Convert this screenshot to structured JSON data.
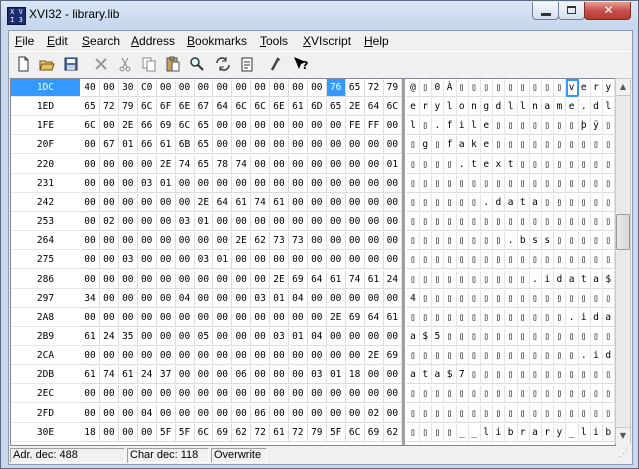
{
  "window": {
    "title": "XVI32 - library.lib",
    "app_icon": "xvi-app-icon",
    "close_glyph": "✕"
  },
  "menu": [
    "File",
    "Edit",
    "Search",
    "Address",
    "Bookmarks",
    "Tools",
    "XVIscript",
    "Help"
  ],
  "menu_hotkeys": [
    "F",
    "E",
    "S",
    "A",
    "B",
    "T",
    "X",
    "H"
  ],
  "toolbar": [
    "new-icon",
    "open-icon",
    "save-icon",
    "delete-icon",
    "cut-icon",
    "copy-icon",
    "paste-icon",
    "find-icon",
    "replace-icon",
    "script-icon",
    "tools-icon",
    "help-icon"
  ],
  "rows": [
    {
      "addr": "1DC",
      "hex": [
        "40",
        "00",
        "30",
        "C0",
        "00",
        "00",
        "00",
        "00",
        "00",
        "00",
        "00",
        "00",
        "00",
        "76",
        "65",
        "72",
        "79",
        "76"
      ],
      "chars": [
        "@",
        "▯",
        "0",
        "À",
        "▯",
        "▯",
        "▯",
        "▯",
        "▯",
        "▯",
        "▯",
        "▯",
        "▯",
        "v",
        "e",
        "r",
        "y",
        "v"
      ]
    },
    {
      "addr": "1ED",
      "hex": [
        "65",
        "72",
        "79",
        "6C",
        "6F",
        "6E",
        "67",
        "64",
        "6C",
        "6C",
        "6E",
        "61",
        "6D",
        "65",
        "2E",
        "64",
        "6C"
      ],
      "chars": [
        "e",
        "r",
        "y",
        "l",
        "o",
        "n",
        "g",
        "d",
        "l",
        "l",
        "n",
        "a",
        "m",
        "e",
        ".",
        "d",
        "l"
      ]
    },
    {
      "addr": "1FE",
      "hex": [
        "6C",
        "00",
        "2E",
        "66",
        "69",
        "6C",
        "65",
        "00",
        "00",
        "00",
        "00",
        "00",
        "00",
        "00",
        "FE",
        "FF",
        "00"
      ],
      "chars": [
        "l",
        "▯",
        ".",
        "f",
        "i",
        "l",
        "e",
        "▯",
        "▯",
        "▯",
        "▯",
        "▯",
        "▯",
        "▯",
        "þ",
        "ÿ",
        "▯"
      ]
    },
    {
      "addr": "20F",
      "hex": [
        "00",
        "67",
        "01",
        "66",
        "61",
        "6B",
        "65",
        "00",
        "00",
        "00",
        "00",
        "00",
        "00",
        "00",
        "00",
        "00",
        "00"
      ],
      "chars": [
        "▯",
        "g",
        "▯",
        "f",
        "a",
        "k",
        "e",
        "▯",
        "▯",
        "▯",
        "▯",
        "▯",
        "▯",
        "▯",
        "▯",
        "▯",
        "▯"
      ]
    },
    {
      "addr": "220",
      "hex": [
        "00",
        "00",
        "00",
        "00",
        "2E",
        "74",
        "65",
        "78",
        "74",
        "00",
        "00",
        "00",
        "00",
        "00",
        "00",
        "00",
        "01"
      ],
      "chars": [
        "▯",
        "▯",
        "▯",
        "▯",
        ".",
        "t",
        "e",
        "x",
        "t",
        "▯",
        "▯",
        "▯",
        "▯",
        "▯",
        "▯",
        "▯",
        "▯"
      ]
    },
    {
      "addr": "231",
      "hex": [
        "00",
        "00",
        "00",
        "03",
        "01",
        "00",
        "00",
        "00",
        "00",
        "00",
        "00",
        "00",
        "00",
        "00",
        "00",
        "00",
        "00"
      ],
      "chars": [
        "▯",
        "▯",
        "▯",
        "▯",
        "▯",
        "▯",
        "▯",
        "▯",
        "▯",
        "▯",
        "▯",
        "▯",
        "▯",
        "▯",
        "▯",
        "▯",
        "▯"
      ]
    },
    {
      "addr": "242",
      "hex": [
        "00",
        "00",
        "00",
        "00",
        "00",
        "00",
        "2E",
        "64",
        "61",
        "74",
        "61",
        "00",
        "00",
        "00",
        "00",
        "00",
        "00"
      ],
      "chars": [
        "▯",
        "▯",
        "▯",
        "▯",
        "▯",
        "▯",
        ".",
        "d",
        "a",
        "t",
        "a",
        "▯",
        "▯",
        "▯",
        "▯",
        "▯",
        "▯"
      ]
    },
    {
      "addr": "253",
      "hex": [
        "00",
        "02",
        "00",
        "00",
        "00",
        "03",
        "01",
        "00",
        "00",
        "00",
        "00",
        "00",
        "00",
        "00",
        "00",
        "00",
        "00"
      ],
      "chars": [
        "▯",
        "▯",
        "▯",
        "▯",
        "▯",
        "▯",
        "▯",
        "▯",
        "▯",
        "▯",
        "▯",
        "▯",
        "▯",
        "▯",
        "▯",
        "▯",
        "▯"
      ]
    },
    {
      "addr": "264",
      "hex": [
        "00",
        "00",
        "00",
        "00",
        "00",
        "00",
        "00",
        "00",
        "2E",
        "62",
        "73",
        "73",
        "00",
        "00",
        "00",
        "00",
        "00"
      ],
      "chars": [
        "▯",
        "▯",
        "▯",
        "▯",
        "▯",
        "▯",
        "▯",
        "▯",
        ".",
        "b",
        "s",
        "s",
        "▯",
        "▯",
        "▯",
        "▯",
        "▯"
      ]
    },
    {
      "addr": "275",
      "hex": [
        "00",
        "00",
        "03",
        "00",
        "00",
        "00",
        "03",
        "01",
        "00",
        "00",
        "00",
        "00",
        "00",
        "00",
        "00",
        "00",
        "00"
      ],
      "chars": [
        "▯",
        "▯",
        "▯",
        "▯",
        "▯",
        "▯",
        "▯",
        "▯",
        "▯",
        "▯",
        "▯",
        "▯",
        "▯",
        "▯",
        "▯",
        "▯",
        "▯"
      ]
    },
    {
      "addr": "286",
      "hex": [
        "00",
        "00",
        "00",
        "00",
        "00",
        "00",
        "00",
        "00",
        "00",
        "00",
        "2E",
        "69",
        "64",
        "61",
        "74",
        "61",
        "24"
      ],
      "chars": [
        "▯",
        "▯",
        "▯",
        "▯",
        "▯",
        "▯",
        "▯",
        "▯",
        "▯",
        "▯",
        ".",
        "i",
        "d",
        "a",
        "t",
        "a",
        "$"
      ]
    },
    {
      "addr": "297",
      "hex": [
        "34",
        "00",
        "00",
        "00",
        "00",
        "04",
        "00",
        "00",
        "00",
        "03",
        "01",
        "04",
        "00",
        "00",
        "00",
        "00",
        "00"
      ],
      "chars": [
        "4",
        "▯",
        "▯",
        "▯",
        "▯",
        "▯",
        "▯",
        "▯",
        "▯",
        "▯",
        "▯",
        "▯",
        "▯",
        "▯",
        "▯",
        "▯",
        "▯"
      ]
    },
    {
      "addr": "2A8",
      "hex": [
        "00",
        "00",
        "00",
        "00",
        "00",
        "00",
        "00",
        "00",
        "00",
        "00",
        "00",
        "00",
        "00",
        "2E",
        "69",
        "64",
        "61",
        "74"
      ],
      "chars": [
        "▯",
        "▯",
        "▯",
        "▯",
        "▯",
        "▯",
        "▯",
        "▯",
        "▯",
        "▯",
        "▯",
        "▯",
        "▯",
        ".",
        "i",
        "d",
        "a",
        "t"
      ]
    },
    {
      "addr": "2B9",
      "hex": [
        "61",
        "24",
        "35",
        "00",
        "00",
        "00",
        "05",
        "00",
        "00",
        "00",
        "03",
        "01",
        "04",
        "00",
        "00",
        "00",
        "00"
      ],
      "chars": [
        "a",
        "$",
        "5",
        "▯",
        "▯",
        "▯",
        "▯",
        "▯",
        "▯",
        "▯",
        "▯",
        "▯",
        "▯",
        "▯",
        "▯",
        "▯",
        "▯"
      ]
    },
    {
      "addr": "2CA",
      "hex": [
        "00",
        "00",
        "00",
        "00",
        "00",
        "00",
        "00",
        "00",
        "00",
        "00",
        "00",
        "00",
        "00",
        "00",
        "00",
        "2E",
        "69",
        "64"
      ],
      "chars": [
        "▯",
        "▯",
        "▯",
        "▯",
        "▯",
        "▯",
        "▯",
        "▯",
        "▯",
        "▯",
        "▯",
        "▯",
        "▯",
        "▯",
        ".",
        "i",
        "d"
      ]
    },
    {
      "addr": "2DB",
      "hex": [
        "61",
        "74",
        "61",
        "24",
        "37",
        "00",
        "00",
        "00",
        "06",
        "00",
        "00",
        "00",
        "03",
        "01",
        "18",
        "00",
        "00"
      ],
      "chars": [
        "a",
        "t",
        "a",
        "$",
        "7",
        "▯",
        "▯",
        "▯",
        "▯",
        "▯",
        "▯",
        "▯",
        "▯",
        "▯",
        "▯",
        "▯",
        "▯"
      ]
    },
    {
      "addr": "2EC",
      "hex": [
        "00",
        "00",
        "00",
        "00",
        "00",
        "00",
        "00",
        "00",
        "00",
        "00",
        "00",
        "00",
        "00",
        "00",
        "00",
        "00",
        "00"
      ],
      "chars": [
        "▯",
        "▯",
        "▯",
        "▯",
        "▯",
        "▯",
        "▯",
        "▯",
        "▯",
        "▯",
        "▯",
        "▯",
        "▯",
        "▯",
        "▯",
        "▯",
        "▯"
      ]
    },
    {
      "addr": "2FD",
      "hex": [
        "00",
        "00",
        "00",
        "04",
        "00",
        "00",
        "00",
        "00",
        "00",
        "06",
        "00",
        "00",
        "00",
        "00",
        "00",
        "02",
        "00"
      ],
      "chars": [
        "▯",
        "▯",
        "▯",
        "▯",
        "▯",
        "▯",
        "▯",
        "▯",
        "▯",
        "▯",
        "▯",
        "▯",
        "▯",
        "▯",
        "▯",
        "▯",
        "▯"
      ]
    },
    {
      "addr": "30E",
      "hex": [
        "18",
        "00",
        "00",
        "00",
        "5F",
        "5F",
        "6C",
        "69",
        "62",
        "72",
        "61",
        "72",
        "79",
        "5F",
        "6C",
        "69",
        "62"
      ],
      "chars": [
        "▯",
        "▯",
        "▯",
        "▯",
        "_",
        "_",
        "l",
        "i",
        "b",
        "r",
        "a",
        "r",
        "y",
        "_",
        "l",
        "i",
        "b"
      ]
    }
  ],
  "cursor": {
    "row": 0,
    "col": 13
  },
  "status": {
    "address": "Adr. dec: 488",
    "char": "Char dec: 118",
    "mode": "Overwrite"
  },
  "colors": {
    "selection": "#3399ff",
    "title_bar": "#c4d6ec",
    "close_button": "#c75050"
  }
}
